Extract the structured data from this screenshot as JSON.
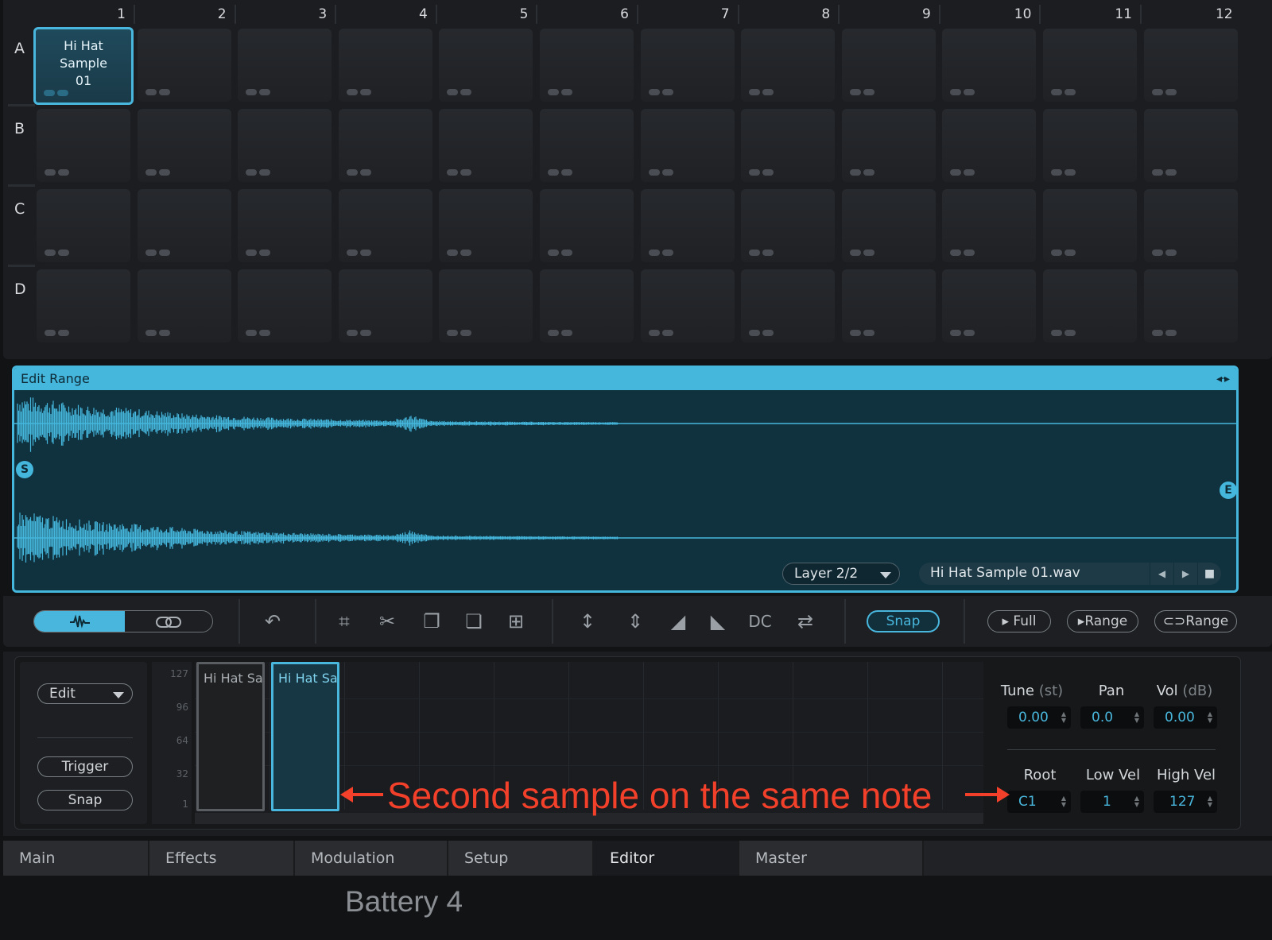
{
  "grid": {
    "columns": [
      "1",
      "2",
      "3",
      "4",
      "5",
      "6",
      "7",
      "8",
      "9",
      "10",
      "11",
      "12"
    ],
    "rows": [
      "A",
      "B",
      "C",
      "D"
    ],
    "selected_cell": {
      "row": "A",
      "column": "1",
      "name": "Hi Hat Sample 01"
    }
  },
  "waveform": {
    "title": "Edit Range",
    "start_marker": "S",
    "end_marker": "E",
    "layer": "Layer 2/2",
    "file": "Hi Hat Sample 01.wav",
    "accent": "#45b6dc",
    "expand_icon": "expand-horizontal-icon"
  },
  "toolbar": {
    "view_mode": [
      "waveform-icon",
      "link-icon"
    ],
    "tools": [
      "undo-icon",
      "crop-icon",
      "cut-icon",
      "copy-icon",
      "paste-icon",
      "duplicate-icon",
      "normalize-icon",
      "silence-icon",
      "fade-in-icon",
      "fade-out-icon",
      "reverse-icon"
    ],
    "dc_label": "DC",
    "snap_label": "Snap",
    "play_full_label": "Full",
    "play_range_label": "Range",
    "loop_range_label": "Range"
  },
  "zone_editor": {
    "edit_label": "Edit",
    "trigger_label": "Trigger",
    "snap_label": "Snap",
    "velocity_ticks": [
      "127",
      "96",
      "64",
      "32",
      "1"
    ],
    "zones": [
      {
        "name": "Hi Hat Sa",
        "selected": false
      },
      {
        "name": "Hi Hat Sa",
        "selected": true
      }
    ],
    "params": {
      "tune_label": "Tune",
      "tune_unit": "(st)",
      "tune_value": "0.00",
      "pan_label": "Pan",
      "pan_value": "0.0",
      "vol_label": "Vol",
      "vol_unit": "(dB)",
      "vol_value": "0.00",
      "root_label": "Root",
      "root_value": "C1",
      "low_vel_label": "Low Vel",
      "low_vel_value": "1",
      "high_vel_label": "High Vel",
      "high_vel_value": "127"
    }
  },
  "annotation": {
    "text": "Second sample on the same note",
    "color": "#f2402a"
  },
  "tabs": [
    "Main",
    "Effects",
    "Modulation",
    "Setup",
    "Editor",
    "Master"
  ],
  "active_tab": "Editor",
  "app_title": "Battery 4"
}
